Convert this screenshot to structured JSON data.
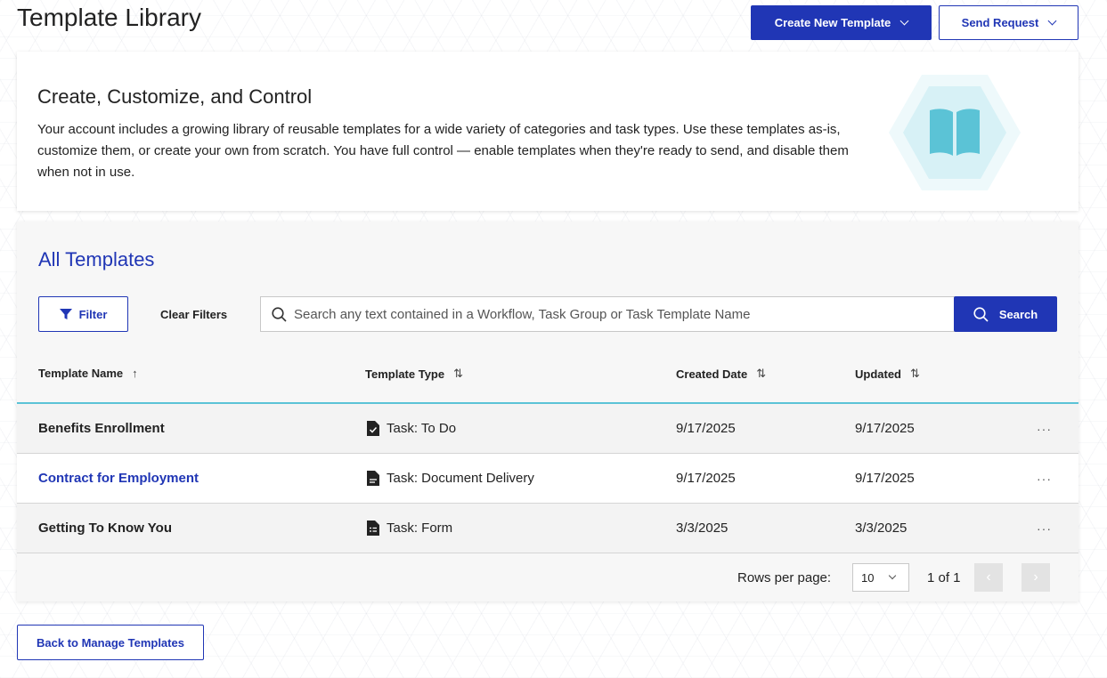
{
  "header": {
    "title": "Template Library",
    "create_button": "Create New Template",
    "send_button": "Send Request"
  },
  "hero": {
    "title": "Create, Customize, and Control",
    "description": "Your account includes a growing library of reusable templates for a wide variety of categories and task types. Use these templates as-is, customize them, or create your own from scratch. You have full control — enable templates when they're ready to send, and disable them when not in use.",
    "icon": "book-icon"
  },
  "templates_section": {
    "title": "All Templates",
    "filter_button": "Filter",
    "clear_filters": "Clear Filters",
    "search_placeholder": "Search any text contained in a Workflow, Task Group or Task Template Name",
    "search_button": "Search",
    "columns": {
      "name": "Template Name",
      "type": "Template Type",
      "created": "Created Date",
      "updated": "Updated"
    },
    "rows": [
      {
        "name": "Benefits Enrollment",
        "type": "Task: To Do",
        "created": "9/17/2025",
        "updated": "9/17/2025",
        "more": "···"
      },
      {
        "name": "Contract for Employment",
        "type": "Task: Document Delivery",
        "created": "9/17/2025",
        "updated": "9/17/2025",
        "more": "···"
      },
      {
        "name": "Getting To Know You",
        "type": "Task: Form",
        "created": "3/3/2025",
        "updated": "3/3/2025",
        "more": "···"
      }
    ],
    "pagination": {
      "rows_per_page_label": "Rows per page:",
      "rows_per_page_value": "10",
      "page_info": "1 of 1"
    }
  },
  "footer": {
    "back_button": "Back to Manage Templates"
  },
  "colors": {
    "primary": "#2036b5",
    "accent": "#5bc3d6"
  }
}
